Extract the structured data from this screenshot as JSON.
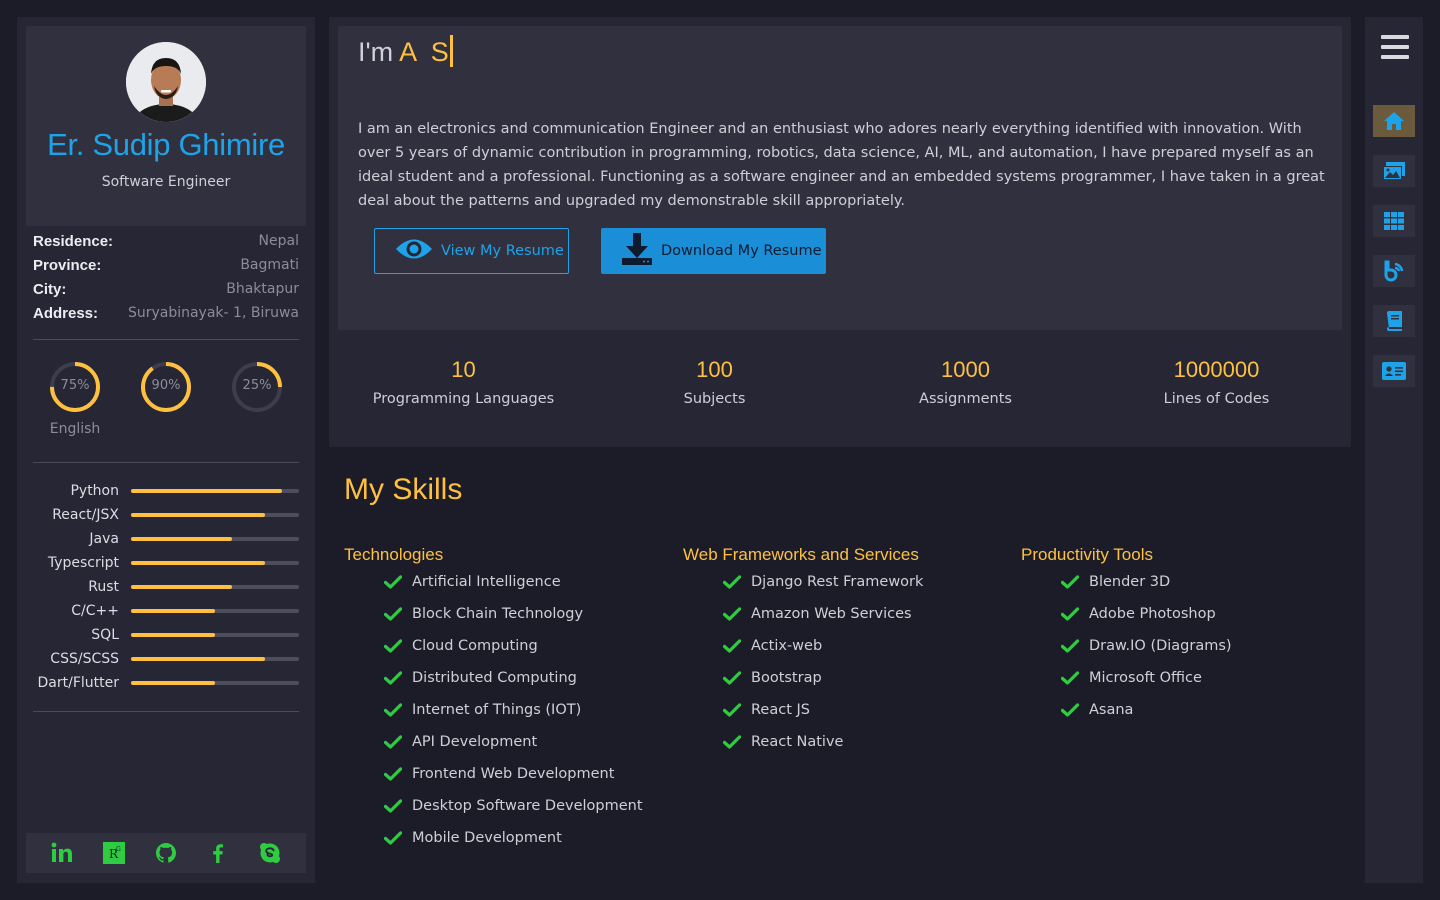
{
  "profile": {
    "name": "Er. Sudip Ghimire",
    "title": "Software Engineer"
  },
  "info": [
    {
      "key": "Residence:",
      "value": "Nepal"
    },
    {
      "key": "Province:",
      "value": "Bagmati"
    },
    {
      "key": "City:",
      "value": "Bhaktapur"
    },
    {
      "key": "Address:",
      "value": "Suryabinayak- 1, Biruwa"
    }
  ],
  "languages": [
    {
      "percent_text": "75%",
      "percent": 75,
      "label": "English"
    },
    {
      "percent_text": "90%",
      "percent": 90,
      "label": ""
    },
    {
      "percent_text": "25%",
      "percent": 25,
      "label": ""
    }
  ],
  "skill_bars": [
    {
      "label": "Python",
      "level": 0.9
    },
    {
      "label": "React/JSX",
      "level": 0.8
    },
    {
      "label": "Java",
      "level": 0.6
    },
    {
      "label": "Typescript",
      "level": 0.8
    },
    {
      "label": "Rust",
      "level": 0.6
    },
    {
      "label": "C/C++",
      "level": 0.5
    },
    {
      "label": "SQL",
      "level": 0.5
    },
    {
      "label": "CSS/SCSS",
      "level": 0.8
    },
    {
      "label": "Dart/Flutter",
      "level": 0.5
    }
  ],
  "socials": [
    "linkedin-icon",
    "researchgate-icon",
    "github-icon",
    "facebook-icon",
    "skype-icon"
  ],
  "hero": {
    "typing_prefix": "I'm",
    "typing_text": "A  S",
    "bio": "I am an electronics and communication Engineer and an enthusiast who adores nearly everything identified with innovation. With over 5 years of dynamic contribution in programming, robotics, data science, AI, ML, and automation, I have prepared myself as an ideal student and a professional. Functioning as a software engineer and an embedded systems programmer, I have taken in a great deal about the patterns and upgraded my demonstrable skill appropriately.",
    "view_button": "View My Resume",
    "download_button": "Download My Resume"
  },
  "stats": [
    {
      "number": "10",
      "label": "Programming Languages"
    },
    {
      "number": "100",
      "label": "Subjects"
    },
    {
      "number": "1000",
      "label": "Assignments"
    },
    {
      "number": "1000000",
      "label": "Lines of Codes"
    }
  ],
  "skills": {
    "title": "My Skills",
    "columns": [
      {
        "heading": "Technologies",
        "items": [
          "Artificial Intelligence",
          "Block Chain Technology",
          "Cloud Computing",
          "Distributed Computing",
          "Internet of Things (IOT)",
          "API Development",
          "Frontend Web Development",
          "Desktop Software Development",
          "Mobile Development"
        ]
      },
      {
        "heading": "Web Frameworks and Services",
        "items": [
          "Django Rest Framework",
          "Amazon Web Services",
          "Actix-web",
          "Bootstrap",
          "React JS",
          "React Native"
        ]
      },
      {
        "heading": "Productivity Tools",
        "items": [
          "Blender 3D",
          "Adobe Photoshop",
          "Draw.IO (Diagrams)",
          "Microsoft Office",
          "Asana"
        ]
      }
    ]
  },
  "nav": [
    "home-icon",
    "gallery-icon",
    "grid-icon",
    "blog-icon",
    "book-icon",
    "contact-card-icon"
  ],
  "colors": {
    "accent": "#ffc040",
    "link": "#1fa3e8",
    "check": "#2ecc40",
    "background": "#1c1c28",
    "panel": "#262634"
  }
}
